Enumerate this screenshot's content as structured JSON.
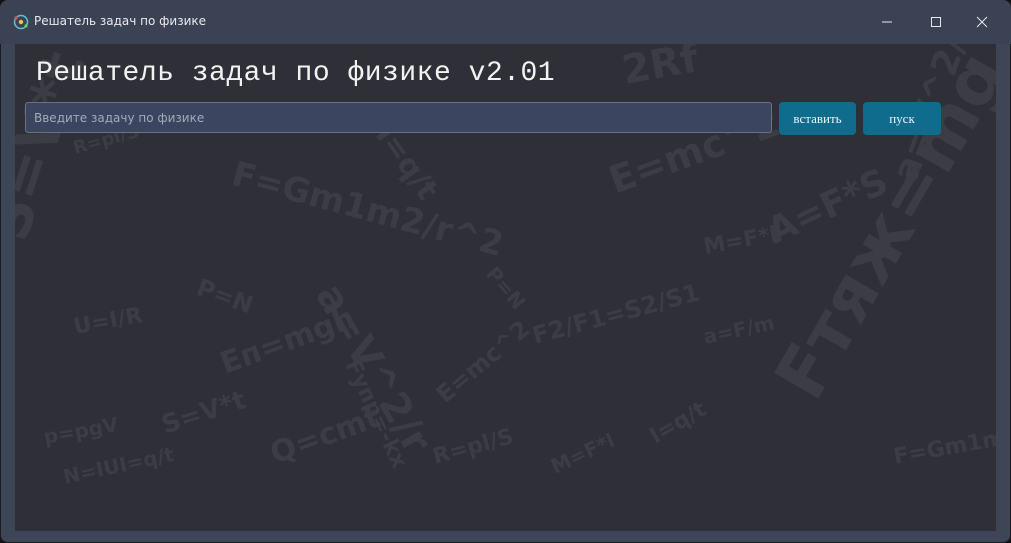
{
  "window": {
    "title": "Решатель задач по физике",
    "icon": "app-icon",
    "controls": [
      "minimize-icon",
      "maximize-icon",
      "close-icon"
    ]
  },
  "app": {
    "heading": "Решатель задач по физике v2.01"
  },
  "input": {
    "value": "",
    "placeholder": "Введите задачу по физике"
  },
  "buttons": {
    "paste_label": "вставить",
    "run_label": "пуск"
  },
  "background_formulas": [
    "S=V*t",
    "R=pl/S",
    "a=F/m",
    "F=Gm1m2/r^2",
    "a=V^2/r",
    "I=q/t",
    "P=N",
    "E=mc^2",
    "M=F*l",
    "A=F*S",
    "Fтяж=mg",
    "U=I/R",
    "p=pgV",
    "Eп=mgh",
    "Fупр=-kx",
    "N=IUI=q/t",
    "2Rf",
    "F2/F1=S2/S1",
    "Q=cmt"
  ],
  "colors": {
    "titlebar": "#3b4253",
    "client_bg": "#2f3037",
    "input_bg": "#3c4560",
    "button_bg": "#106c8d",
    "formula_text": "#3c3d44"
  }
}
